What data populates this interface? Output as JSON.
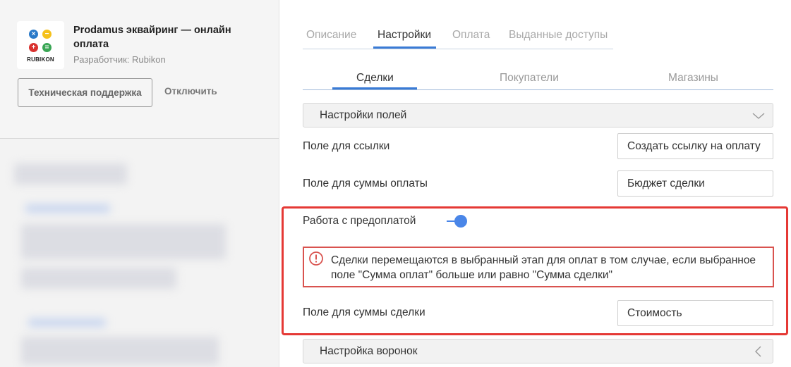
{
  "app": {
    "logo_text": "RUBIKON",
    "title": "Prodamus эквайринг — онлайн оплата",
    "developer": "Разработчик: Rubikon",
    "support_button": "Техническая поддержка",
    "disable_link": "Отключить"
  },
  "tabs": [
    {
      "label": "Описание"
    },
    {
      "label": "Настройки"
    },
    {
      "label": "Оплата"
    },
    {
      "label": "Выданные доступы"
    }
  ],
  "subtabs": [
    {
      "label": "Сделки"
    },
    {
      "label": "Покупатели"
    },
    {
      "label": "Магазины"
    }
  ],
  "sections": {
    "fields_settings": "Настройки полей",
    "funnels_settings": "Настройка воронок"
  },
  "fields": {
    "link_label": "Поле для ссылки",
    "link_value": "Создать ссылку на оплату",
    "payment_sum_label": "Поле для суммы оплаты",
    "payment_sum_value": "Бюджет сделки",
    "prepayment_label": "Работа с предоплатой",
    "prepayment_enabled": true,
    "warning_text": "Сделки перемещаются в выбранный этап для оплат в том случае, если выбранное поле \"Сумма оплат\" больше или равно \"Сумма сделки\"",
    "deal_sum_label": "Поле для суммы сделки",
    "deal_sum_value": "Стоимость"
  },
  "colors": {
    "accent": "#3a7bd5",
    "toggle": "#4a86e8",
    "highlight": "#e53935",
    "warning_border": "#d9534f"
  }
}
